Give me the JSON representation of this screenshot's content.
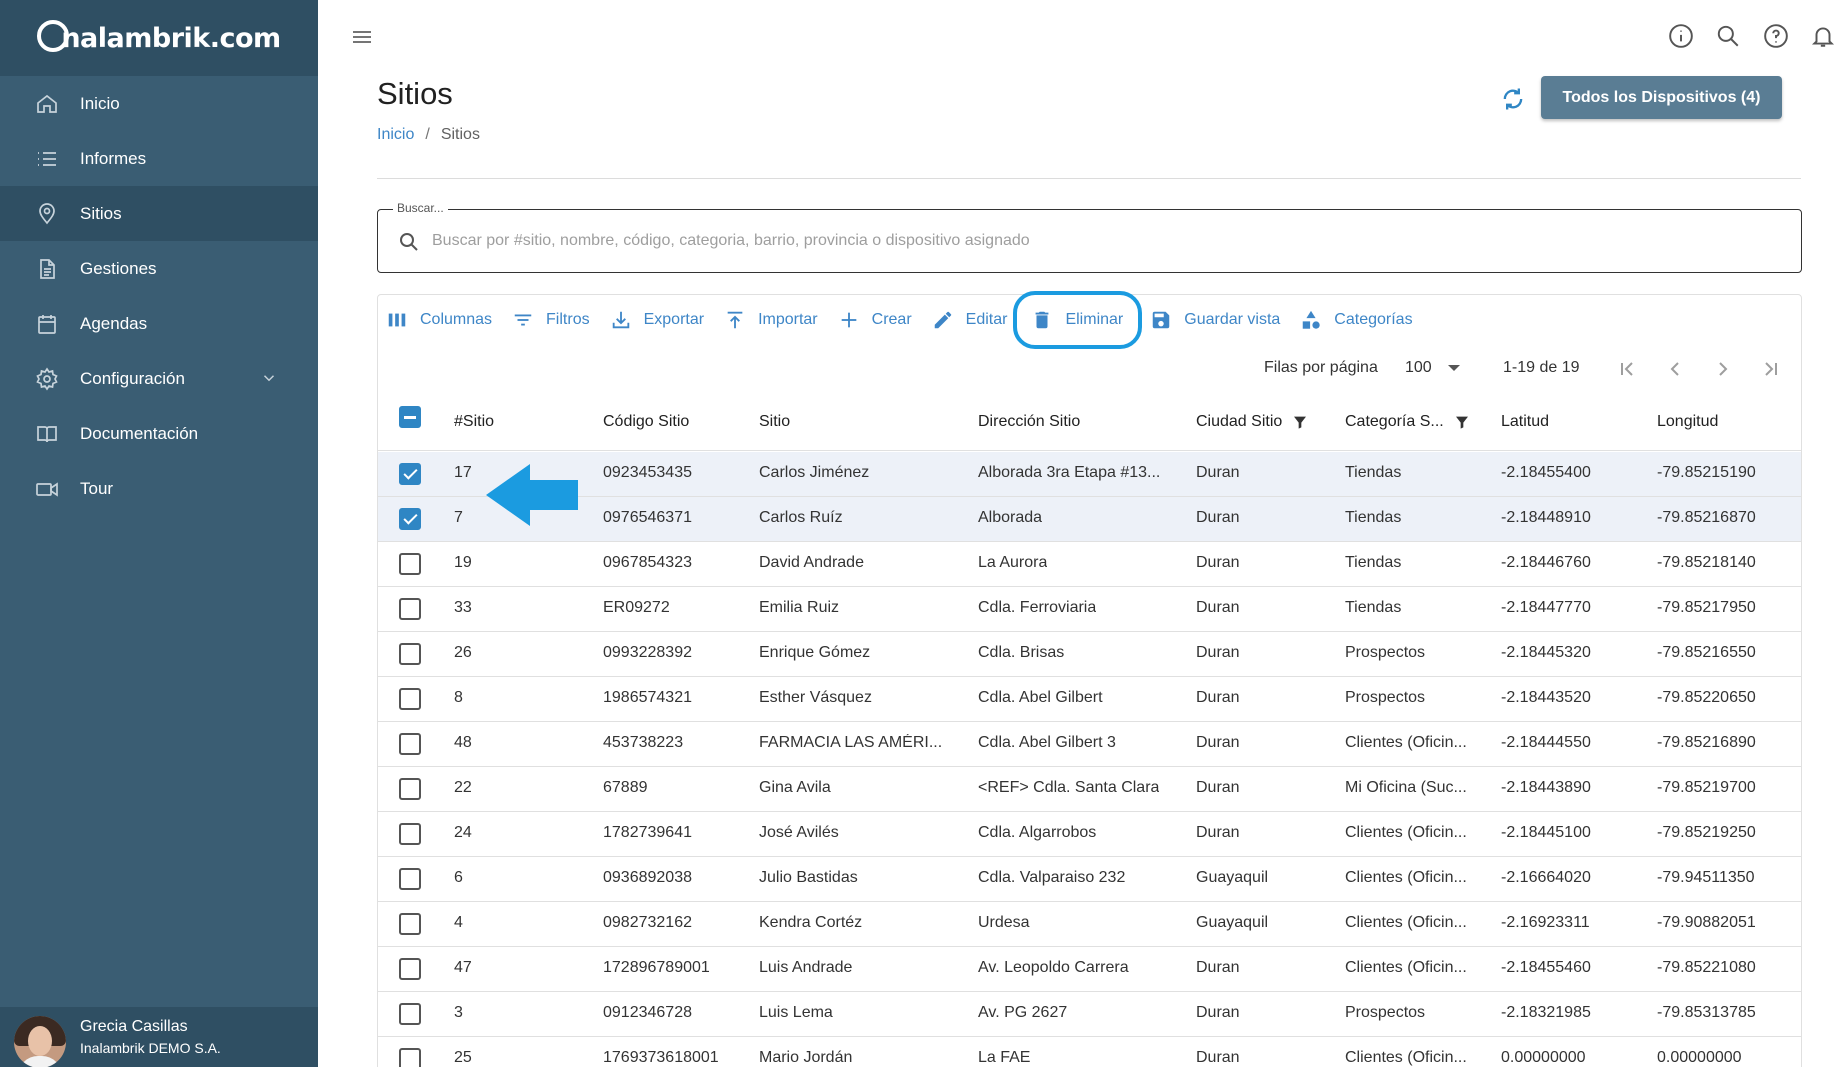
{
  "brand": {
    "logo_text": "nalambrik.com"
  },
  "sidebar": {
    "items": [
      {
        "label": "Inicio",
        "icon": "home-icon"
      },
      {
        "label": "Informes",
        "icon": "list-icon"
      },
      {
        "label": "Sitios",
        "icon": "location-pin-icon",
        "active": true
      },
      {
        "label": "Gestiones",
        "icon": "document-icon"
      },
      {
        "label": "Agendas",
        "icon": "calendar-icon"
      },
      {
        "label": "Configuración",
        "icon": "gear-icon",
        "expandable": true
      },
      {
        "label": "Documentación",
        "icon": "book-icon"
      },
      {
        "label": "Tour",
        "icon": "video-camera-icon"
      }
    ],
    "user": {
      "name": "Grecia Casillas",
      "org": "Inalambrik DEMO S.A."
    }
  },
  "header": {
    "title": "Sitios",
    "breadcrumb": {
      "home": "Inicio",
      "sep": "/",
      "current": "Sitios"
    },
    "devices_button": "Todos los Dispositivos (4)"
  },
  "search": {
    "label": "Buscar...",
    "placeholder": "Buscar por #sitio, nombre, código, categoria, barrio, provincia o dispositivo asignado",
    "value": ""
  },
  "toolbar": {
    "columns": "Columnas",
    "filters": "Filtros",
    "export": "Exportar",
    "import": "Importar",
    "create": "Crear",
    "edit": "Editar",
    "delete": "Eliminar",
    "save_view": "Guardar vista",
    "categories": "Categorías"
  },
  "pagination": {
    "rows_label": "Filas por página",
    "rows_value": "100",
    "range": "1-19 de 19"
  },
  "colors": {
    "sidebar": "#3a5d73",
    "sidebar_dark": "#2f4f63",
    "accent": "#3e86c7",
    "highlight_ring": "#1b9be0"
  },
  "table": {
    "columns": [
      "#Sitio",
      "Código Sitio",
      "Sitio",
      "Dirección Sitio",
      "Ciudad Sitio",
      "Categoría S...",
      "Latitud",
      "Longitud"
    ],
    "rows": [
      {
        "checked": true,
        "id": "17",
        "code": "0923453435",
        "site": "Carlos Jiménez",
        "address": "Alborada 3ra Etapa #13...",
        "city": "Duran",
        "category": "Tiendas",
        "lat": "-2.18455400",
        "lon": "-79.85215190"
      },
      {
        "checked": true,
        "id": "7",
        "code": "0976546371",
        "site": "Carlos Ruíz",
        "address": "Alborada",
        "city": "Duran",
        "category": "Tiendas",
        "lat": "-2.18448910",
        "lon": "-79.85216870"
      },
      {
        "checked": false,
        "id": "19",
        "code": "0967854323",
        "site": "David Andrade",
        "address": "La Aurora",
        "city": "Duran",
        "category": "Tiendas",
        "lat": "-2.18446760",
        "lon": "-79.85218140"
      },
      {
        "checked": false,
        "id": "33",
        "code": "ER09272",
        "site": "Emilia Ruiz",
        "address": "Cdla. Ferroviaria",
        "city": "Duran",
        "category": "Tiendas",
        "lat": "-2.18447770",
        "lon": "-79.85217950"
      },
      {
        "checked": false,
        "id": "26",
        "code": "0993228392",
        "site": "Enrique Gómez",
        "address": "Cdla. Brisas",
        "city": "Duran",
        "category": "Prospectos",
        "lat": "-2.18445320",
        "lon": "-79.85216550"
      },
      {
        "checked": false,
        "id": "8",
        "code": "1986574321",
        "site": "Esther Vásquez",
        "address": "Cdla. Abel Gilbert",
        "city": "Duran",
        "category": "Prospectos",
        "lat": "-2.18443520",
        "lon": "-79.85220650"
      },
      {
        "checked": false,
        "id": "48",
        "code": "453738223",
        "site": "FARMACIA LAS AMÉRI...",
        "address": "Cdla. Abel Gilbert 3",
        "city": "Duran",
        "category": "Clientes (Oficin...",
        "lat": "-2.18444550",
        "lon": "-79.85216890"
      },
      {
        "checked": false,
        "id": "22",
        "code": "67889",
        "site": "Gina Avila",
        "address": "<REF> Cdla. Santa Clara",
        "city": "Duran",
        "category": "Mi Oficina (Suc...",
        "lat": "-2.18443890",
        "lon": "-79.85219700"
      },
      {
        "checked": false,
        "id": "24",
        "code": "1782739641",
        "site": "José Avilés",
        "address": "Cdla. Algarrobos",
        "city": "Duran",
        "category": "Clientes (Oficin...",
        "lat": "-2.18445100",
        "lon": "-79.85219250"
      },
      {
        "checked": false,
        "id": "6",
        "code": "0936892038",
        "site": "Julio Bastidas",
        "address": "Cdla. Valparaiso 232",
        "city": "Guayaquil",
        "category": "Clientes (Oficin...",
        "lat": "-2.16664020",
        "lon": "-79.94511350"
      },
      {
        "checked": false,
        "id": "4",
        "code": "0982732162",
        "site": "Kendra Cortéz",
        "address": "Urdesa",
        "city": "Guayaquil",
        "category": "Clientes (Oficin...",
        "lat": "-2.16923311",
        "lon": "-79.90882051"
      },
      {
        "checked": false,
        "id": "47",
        "code": "172896789001",
        "site": "Luis Andrade",
        "address": "Av. Leopoldo Carrera",
        "city": "Duran",
        "category": "Clientes (Oficin...",
        "lat": "-2.18455460",
        "lon": "-79.85221080"
      },
      {
        "checked": false,
        "id": "3",
        "code": "0912346728",
        "site": "Luis Lema",
        "address": "Av. PG 2627",
        "city": "Duran",
        "category": "Prospectos",
        "lat": "-2.18321985",
        "lon": "-79.85313785"
      },
      {
        "checked": false,
        "id": "25",
        "code": "1769373618001",
        "site": "Mario Jordán",
        "address": "La FAE",
        "city": "Duran",
        "category": "Clientes (Oficin...",
        "lat": "0.00000000",
        "lon": "0.00000000"
      }
    ]
  }
}
